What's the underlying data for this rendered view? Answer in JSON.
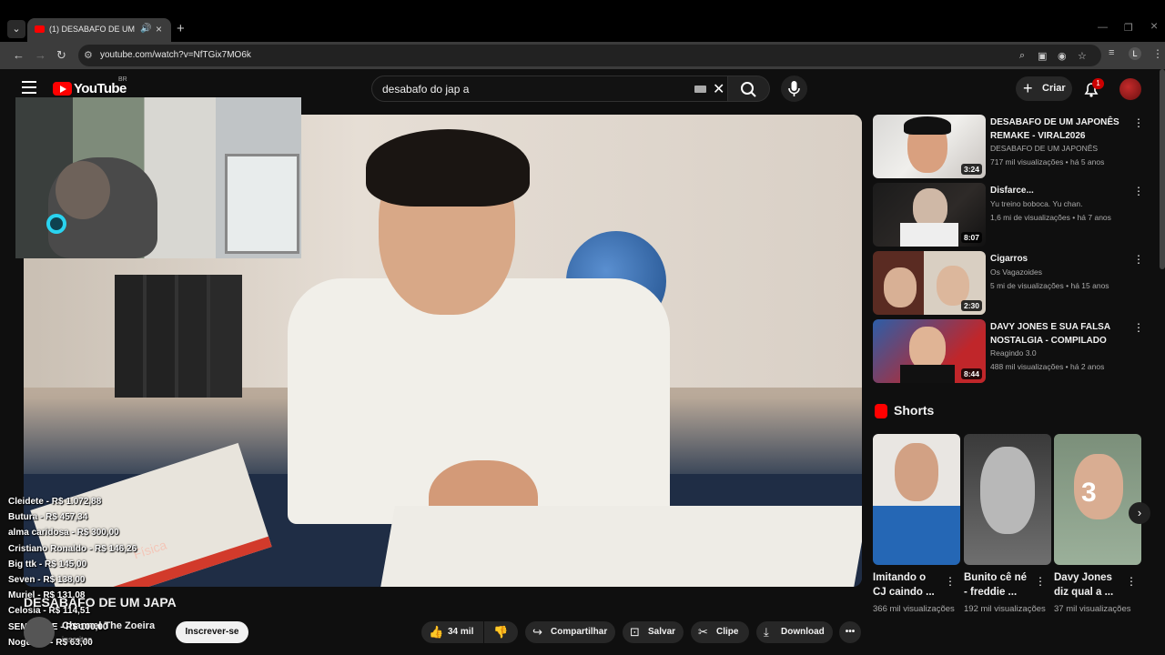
{
  "browser": {
    "tab_title": "(1) DESABAFO DE UM JAPA",
    "url": "youtube.com/watch?v=NfTGix7MO6k",
    "profile_letter": "L"
  },
  "header": {
    "logo_text": "YouTube",
    "country_code": "BR",
    "search_query": "desabafo do jap a",
    "create_label": "Criar",
    "notification_count": "1"
  },
  "donations": [
    "Cleidete - R$ 1.072,88",
    "Butura - R$ 457,34",
    "alma caridosa - R$ 300,00",
    "Cristiano Ronaldo - R$ 146,26",
    "Big ttk - R$ 145,00",
    "Seven - R$ 138,00",
    "Muriel - R$ 131,08",
    "Celosia - R$ 114,51",
    "SEM NOME - R$ 100,00",
    "Nogueira - R$ 63,00"
  ],
  "video": {
    "book_label": "Física",
    "title": "DESABAFO DE UM JAPA",
    "channel": "Channel The Zoeira",
    "subscribers": "inscritos",
    "subscribe_label": "Inscrever-se",
    "likes": "34 mil",
    "share_label": "Compartilhar",
    "save_label": "Salvar",
    "clip_label": "Clipe",
    "download_label": "Download"
  },
  "recommendations": [
    {
      "title": "DESABAFO DE UM JAPONÊS REMAKE - VIRAL2026",
      "channel": "DESABAFO DE UM JAPONÊS",
      "meta": "717 mil visualizações • há 5 anos",
      "duration": "3:24"
    },
    {
      "title": "Disfarce...",
      "channel": "Yu treino boboca. Yu chan.",
      "meta": "1,6 mi de visualizações • há 7 anos",
      "duration": "8:07"
    },
    {
      "title": "Cigarros",
      "channel": "Os Vagazoides",
      "meta": "5 mi de visualizações • há 15 anos",
      "duration": "2:30"
    },
    {
      "title": "DAVY JONES E SUA FALSA NOSTALGIA - COMPILADO",
      "channel": "Reagindo 3.0",
      "meta": "488 mil visualizações • há 2 anos",
      "duration": "8:44"
    }
  ],
  "shorts": {
    "heading": "Shorts",
    "items": [
      {
        "title": "Imitando o CJ caindo ...",
        "views": "366 mil visualizações",
        "overlay": ""
      },
      {
        "title": "Bunito cê né - freddie ...",
        "views": "192 mil visualizações",
        "overlay": ""
      },
      {
        "title": "Davy Jones diz qual a ...",
        "views": "37 mil visualizações",
        "overlay": "3"
      }
    ]
  }
}
